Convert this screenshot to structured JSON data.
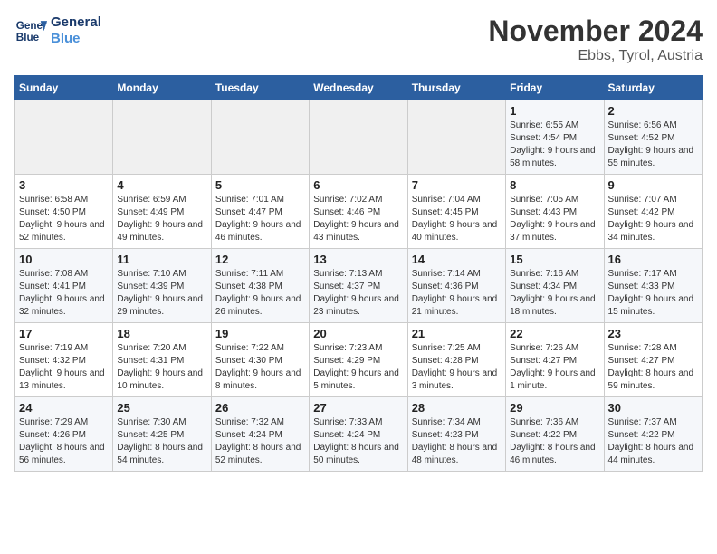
{
  "logo": {
    "line1": "General",
    "line2": "Blue"
  },
  "title": "November 2024",
  "location": "Ebbs, Tyrol, Austria",
  "days_of_week": [
    "Sunday",
    "Monday",
    "Tuesday",
    "Wednesday",
    "Thursday",
    "Friday",
    "Saturday"
  ],
  "weeks": [
    [
      {
        "day": "",
        "info": ""
      },
      {
        "day": "",
        "info": ""
      },
      {
        "day": "",
        "info": ""
      },
      {
        "day": "",
        "info": ""
      },
      {
        "day": "",
        "info": ""
      },
      {
        "day": "1",
        "info": "Sunrise: 6:55 AM\nSunset: 4:54 PM\nDaylight: 9 hours and 58 minutes."
      },
      {
        "day": "2",
        "info": "Sunrise: 6:56 AM\nSunset: 4:52 PM\nDaylight: 9 hours and 55 minutes."
      }
    ],
    [
      {
        "day": "3",
        "info": "Sunrise: 6:58 AM\nSunset: 4:50 PM\nDaylight: 9 hours and 52 minutes."
      },
      {
        "day": "4",
        "info": "Sunrise: 6:59 AM\nSunset: 4:49 PM\nDaylight: 9 hours and 49 minutes."
      },
      {
        "day": "5",
        "info": "Sunrise: 7:01 AM\nSunset: 4:47 PM\nDaylight: 9 hours and 46 minutes."
      },
      {
        "day": "6",
        "info": "Sunrise: 7:02 AM\nSunset: 4:46 PM\nDaylight: 9 hours and 43 minutes."
      },
      {
        "day": "7",
        "info": "Sunrise: 7:04 AM\nSunset: 4:45 PM\nDaylight: 9 hours and 40 minutes."
      },
      {
        "day": "8",
        "info": "Sunrise: 7:05 AM\nSunset: 4:43 PM\nDaylight: 9 hours and 37 minutes."
      },
      {
        "day": "9",
        "info": "Sunrise: 7:07 AM\nSunset: 4:42 PM\nDaylight: 9 hours and 34 minutes."
      }
    ],
    [
      {
        "day": "10",
        "info": "Sunrise: 7:08 AM\nSunset: 4:41 PM\nDaylight: 9 hours and 32 minutes."
      },
      {
        "day": "11",
        "info": "Sunrise: 7:10 AM\nSunset: 4:39 PM\nDaylight: 9 hours and 29 minutes."
      },
      {
        "day": "12",
        "info": "Sunrise: 7:11 AM\nSunset: 4:38 PM\nDaylight: 9 hours and 26 minutes."
      },
      {
        "day": "13",
        "info": "Sunrise: 7:13 AM\nSunset: 4:37 PM\nDaylight: 9 hours and 23 minutes."
      },
      {
        "day": "14",
        "info": "Sunrise: 7:14 AM\nSunset: 4:36 PM\nDaylight: 9 hours and 21 minutes."
      },
      {
        "day": "15",
        "info": "Sunrise: 7:16 AM\nSunset: 4:34 PM\nDaylight: 9 hours and 18 minutes."
      },
      {
        "day": "16",
        "info": "Sunrise: 7:17 AM\nSunset: 4:33 PM\nDaylight: 9 hours and 15 minutes."
      }
    ],
    [
      {
        "day": "17",
        "info": "Sunrise: 7:19 AM\nSunset: 4:32 PM\nDaylight: 9 hours and 13 minutes."
      },
      {
        "day": "18",
        "info": "Sunrise: 7:20 AM\nSunset: 4:31 PM\nDaylight: 9 hours and 10 minutes."
      },
      {
        "day": "19",
        "info": "Sunrise: 7:22 AM\nSunset: 4:30 PM\nDaylight: 9 hours and 8 minutes."
      },
      {
        "day": "20",
        "info": "Sunrise: 7:23 AM\nSunset: 4:29 PM\nDaylight: 9 hours and 5 minutes."
      },
      {
        "day": "21",
        "info": "Sunrise: 7:25 AM\nSunset: 4:28 PM\nDaylight: 9 hours and 3 minutes."
      },
      {
        "day": "22",
        "info": "Sunrise: 7:26 AM\nSunset: 4:27 PM\nDaylight: 9 hours and 1 minute."
      },
      {
        "day": "23",
        "info": "Sunrise: 7:28 AM\nSunset: 4:27 PM\nDaylight: 8 hours and 59 minutes."
      }
    ],
    [
      {
        "day": "24",
        "info": "Sunrise: 7:29 AM\nSunset: 4:26 PM\nDaylight: 8 hours and 56 minutes."
      },
      {
        "day": "25",
        "info": "Sunrise: 7:30 AM\nSunset: 4:25 PM\nDaylight: 8 hours and 54 minutes."
      },
      {
        "day": "26",
        "info": "Sunrise: 7:32 AM\nSunset: 4:24 PM\nDaylight: 8 hours and 52 minutes."
      },
      {
        "day": "27",
        "info": "Sunrise: 7:33 AM\nSunset: 4:24 PM\nDaylight: 8 hours and 50 minutes."
      },
      {
        "day": "28",
        "info": "Sunrise: 7:34 AM\nSunset: 4:23 PM\nDaylight: 8 hours and 48 minutes."
      },
      {
        "day": "29",
        "info": "Sunrise: 7:36 AM\nSunset: 4:22 PM\nDaylight: 8 hours and 46 minutes."
      },
      {
        "day": "30",
        "info": "Sunrise: 7:37 AM\nSunset: 4:22 PM\nDaylight: 8 hours and 44 minutes."
      }
    ]
  ]
}
